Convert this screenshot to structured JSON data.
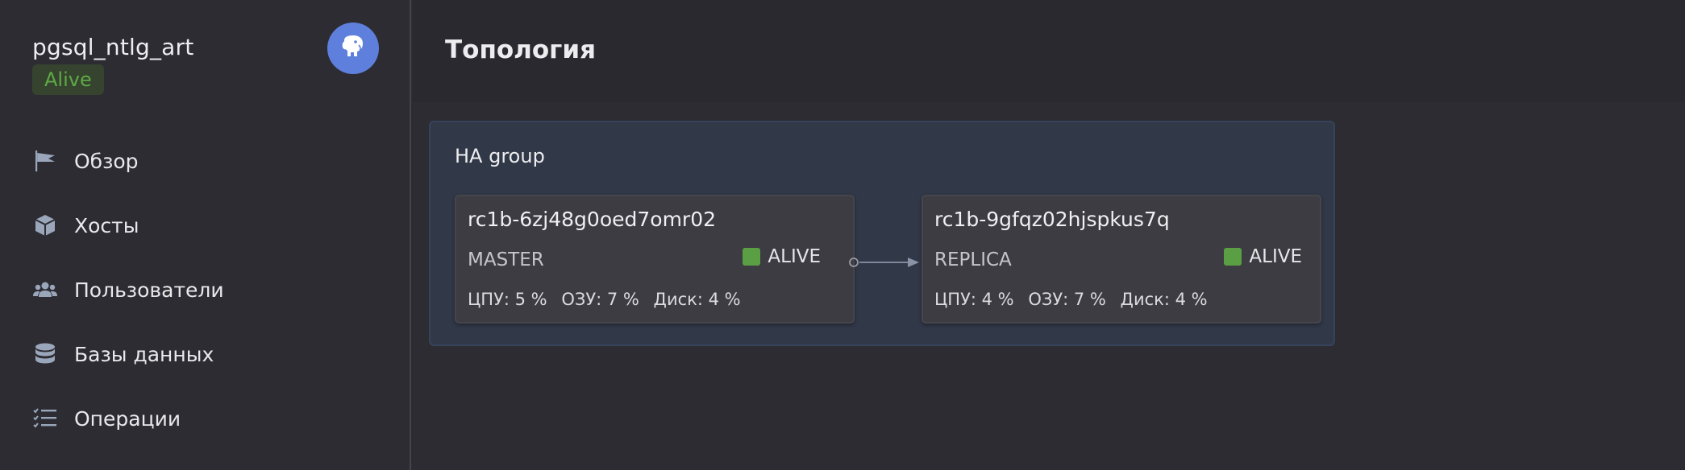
{
  "cluster": {
    "name": "pgsql_ntlg_art",
    "status": "Alive",
    "avatar_icon": "elephant-icon"
  },
  "nav": {
    "items": [
      {
        "label": "Обзор",
        "icon": "flag-icon"
      },
      {
        "label": "Хосты",
        "icon": "cube-icon"
      },
      {
        "label": "Пользователи",
        "icon": "users-icon"
      },
      {
        "label": "Базы данных",
        "icon": "database-icon"
      },
      {
        "label": "Операции",
        "icon": "list-check-icon"
      }
    ]
  },
  "main": {
    "title": "Топология",
    "ha_group": {
      "title": "HA group",
      "hosts": [
        {
          "name": "rc1b-6zj48g0oed7omr02",
          "role": "MASTER",
          "status": "ALIVE",
          "cpu": "ЦПУ: 5 %",
          "ram": "ОЗУ: 7 %",
          "disk": "Диск: 4 %"
        },
        {
          "name": "rc1b-9gfqz02hjspkus7q",
          "role": "REPLICA",
          "status": "ALIVE",
          "cpu": "ЦПУ: 4 %",
          "ram": "ОЗУ: 7 %",
          "disk": "Диск: 4 %"
        }
      ]
    }
  },
  "colors": {
    "alive_green": "#5a9f44",
    "avatar_blue": "#5e7fdc",
    "ha_group_bg": "#313848",
    "card_bg": "#3d3c42"
  }
}
